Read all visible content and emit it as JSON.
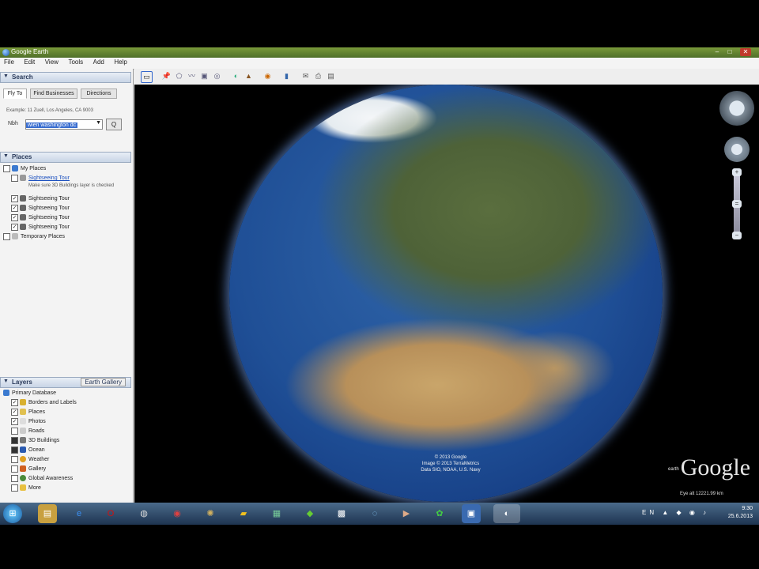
{
  "window": {
    "title": "Google Earth",
    "controls": [
      "–",
      "□",
      "✕"
    ]
  },
  "menu": [
    "File",
    "Edit",
    "View",
    "Tools",
    "Add",
    "Help"
  ],
  "search": {
    "header": "Search",
    "tabs": [
      "Fly To",
      "Find Businesses",
      "Directions"
    ],
    "hint": "Example: 11 Zuell, Los Angeles, CA 9003",
    "input_prefix": "Nbh",
    "input_value": "wien washington dc",
    "go_label": "Q"
  },
  "places": {
    "header": "Places",
    "items": [
      {
        "label": "My Places",
        "checked": false,
        "link": false
      },
      {
        "label": "Sightseeing Tour",
        "checked": false,
        "link": true,
        "desc": "Make sure 3D Buildings layer is checked"
      },
      {
        "label": "Sightseeing Tour",
        "checked": true,
        "link": false
      },
      {
        "label": "Sightseeing Tour",
        "checked": true,
        "link": false
      },
      {
        "label": "Sightseeing Tour",
        "checked": true,
        "link": false
      },
      {
        "label": "Sightseeing Tour",
        "checked": true,
        "link": false
      },
      {
        "label": "Temporary Places",
        "checked": false,
        "link": false
      }
    ]
  },
  "layers": {
    "header": "Layers",
    "gallery": "Earth Gallery",
    "items": [
      {
        "label": "Primary Database",
        "checked": false
      },
      {
        "label": "Borders and Labels",
        "checked": true
      },
      {
        "label": "Places",
        "checked": true
      },
      {
        "label": "Photos",
        "checked": true
      },
      {
        "label": "Roads",
        "checked": false
      },
      {
        "label": "3D Buildings",
        "checked": false
      },
      {
        "label": "Ocean",
        "checked": false
      },
      {
        "label": "Weather",
        "checked": false
      },
      {
        "label": "Gallery",
        "checked": false
      },
      {
        "label": "Global Awareness",
        "checked": false
      },
      {
        "label": "More",
        "checked": false
      }
    ]
  },
  "map": {
    "logo": "Google",
    "logo_prefix": "earth",
    "status": "Eye alt 12221.99 km",
    "copyright_lines": [
      "© 2013 Google",
      "Image © 2013 TerraMetrics",
      "Data SIO, NOAA, U.S. Navy"
    ]
  },
  "taskbar": {
    "clock_time": "9:30",
    "clock_date": "25.6.2013",
    "tray": "EN ▲ ◆ ◉ ♪"
  },
  "colors": {
    "titlebar": "#5a7a30",
    "panel_header": "#c8d5e6",
    "taskbar": "#1e3450",
    "accent": "#2f64a8"
  }
}
